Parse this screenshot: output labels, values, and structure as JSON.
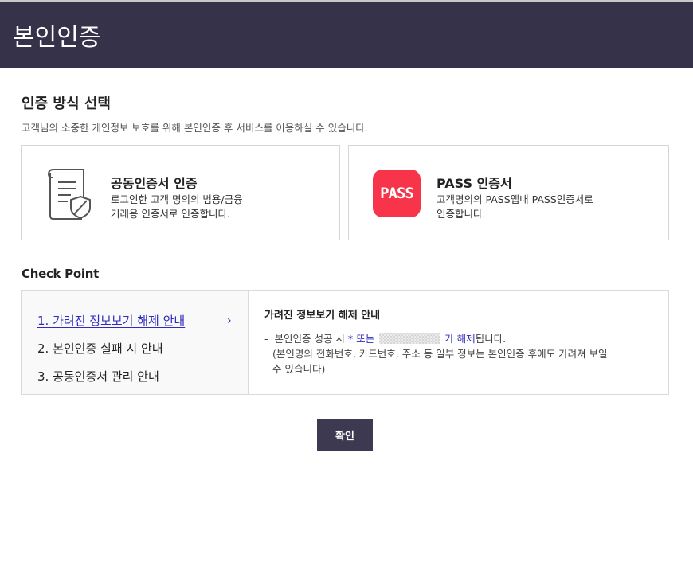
{
  "header": {
    "title": "본인인증"
  },
  "selection": {
    "title": "인증 방식 선택",
    "subtitle": "고객님의 소중한 개인정보 보호를 위해 본인인증 후 서비스를 이용하실 수 있습니다."
  },
  "methods": [
    {
      "title": "공동인증서 인증",
      "desc1": "로그인한 고객 명의의 범용/금융",
      "desc2": "거래용 인증서로 인증합니다.",
      "icon": "certificate-document-shield-icon"
    },
    {
      "title": "PASS 인증서",
      "desc1": "고객명의의 PASS앱내 PASS인증서로",
      "desc2": "인증합니다.",
      "icon": "pass-logo",
      "badge": "PASS",
      "badge_color": "#f7344a"
    }
  ],
  "checkpoint": {
    "title": "Check Point",
    "items": [
      {
        "label": "1. 가려진 정보보기 해제 안내",
        "active": true
      },
      {
        "label": "2. 본인인증 실패 시 안내",
        "active": false
      },
      {
        "label": "3. 공동인증서 관리 안내",
        "active": false
      }
    ],
    "active_chevron": "›",
    "detail": {
      "title": "가려진 정보보기 해제 안내",
      "dash": "-",
      "line1_a": "본인인증 성공 시",
      "line1_b": "* 또는",
      "line1_c": "가 해제",
      "line1_d": "됩니다.",
      "line2": "(본인명의 전화번호, 카드번호, 주소 등 일부 정보는 본인인증 후에도 가려져 보일",
      "line3": "수 있습니다)"
    }
  },
  "confirm_label": "확인",
  "colors": {
    "header_bg": "#35324a",
    "accent": "#2e2bbd",
    "button_bg": "#3c3950"
  }
}
